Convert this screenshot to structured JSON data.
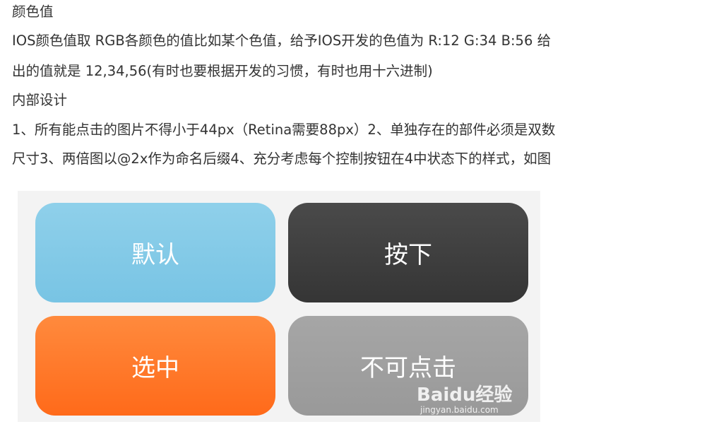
{
  "paragraphs": [
    "颜色值",
    "IOS颜色值取 RGB各颜色的值比如某个色值，给予IOS开发的色值为 R:12 G:34 B:56 给",
    "出的值就是 12,34,56(有时也要根据开发的习惯，有时也用十六进制)",
    "内部设计",
    "1、所有能点击的图片不得小于44px（Retina需要88px）2、单独存在的部件必须是双数",
    "尺寸3、两倍图以@2x作为命名后缀4、充分考虑每个控制按钮在4中状态下的样式，如图"
  ],
  "figure": {
    "buttons": [
      "默认",
      "按下",
      "选中",
      "不可点击"
    ],
    "watermark": "Baidu经验",
    "watermark_url": "jingyan.baidu.com",
    "colors": {
      "default": "#82c9e7",
      "pressed": "#3f3f3f",
      "selected": "#ff7a2a",
      "disabled": "#a0a0a0"
    }
  }
}
